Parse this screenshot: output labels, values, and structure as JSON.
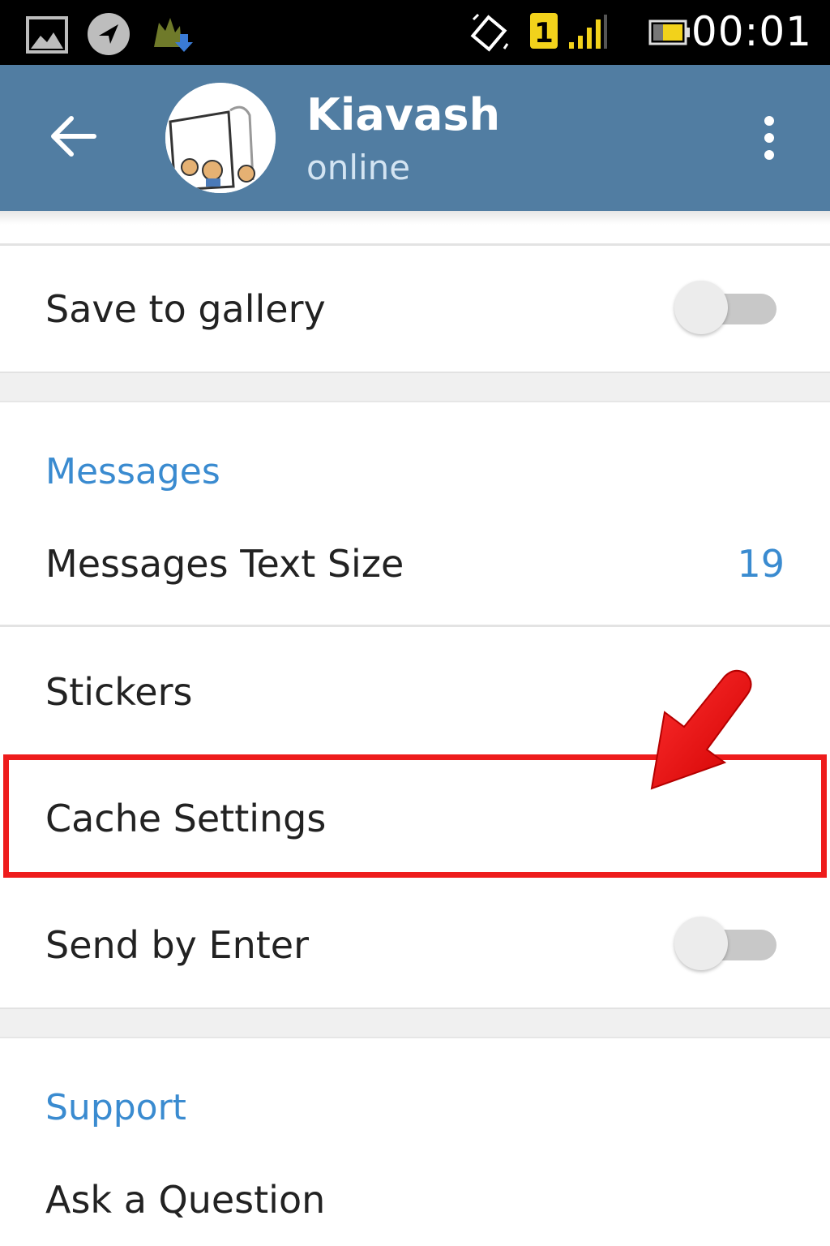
{
  "status_bar": {
    "time": "00:01",
    "sim_label": "1",
    "icons": [
      "gallery-icon",
      "navigation-icon",
      "download-icon",
      "vibrate-icon",
      "sim-icon",
      "signal-icon",
      "battery-icon"
    ]
  },
  "app_bar": {
    "title": "Kiavash",
    "subtitle": "online",
    "icons": [
      "back-arrow-icon",
      "more-vert-icon"
    ],
    "color": "#517da2"
  },
  "settings": {
    "save_to_gallery": {
      "label": "Save to gallery",
      "enabled": false
    },
    "messages_header": "Messages",
    "messages_text_size": {
      "label": "Messages Text Size",
      "value": "19"
    },
    "stickers": {
      "label": "Stickers"
    },
    "cache_settings": {
      "label": "Cache Settings"
    },
    "send_by_enter": {
      "label": "Send by Enter",
      "enabled": false
    },
    "support_header": "Support",
    "ask_question": {
      "label": "Ask a Question"
    }
  },
  "annotation": {
    "highlight_color": "#ee1c1c",
    "icons": [
      "annotation-arrow-icon"
    ]
  }
}
